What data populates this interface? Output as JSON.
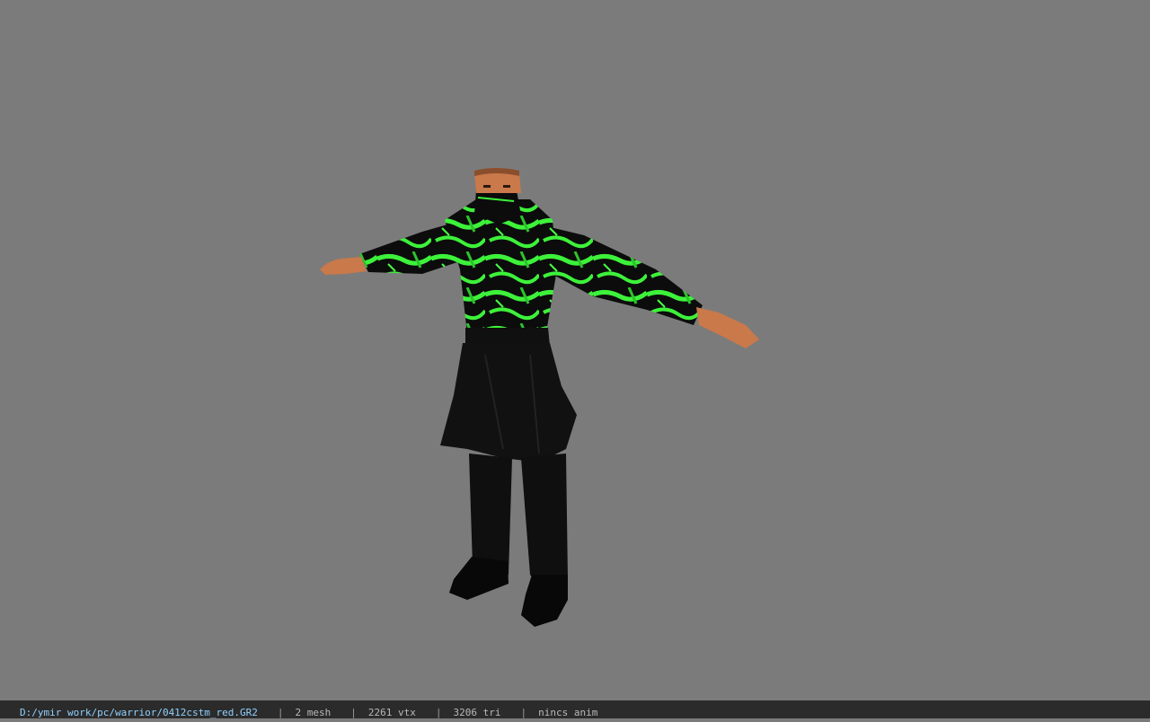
{
  "viewer": {
    "background_color": "#7b7b7b",
    "model_description": "3D warrior character in T-pose wearing black outfit with green patterned jacket"
  },
  "statusbar": {
    "path": "D:/ymir work/pc/warrior/0412cstm_red.GR2",
    "separator": "|",
    "mesh": "2 mesh",
    "vtx": "2261 vtx",
    "tri": "3206 tri",
    "anim": "nincs anim"
  },
  "colors": {
    "outfit_black": "#0d0d0d",
    "outfit_green": "#3df23a",
    "skin": "#c9794a",
    "statusbar_bg": "#2b2b2b",
    "path_text": "#8fd0ff"
  }
}
